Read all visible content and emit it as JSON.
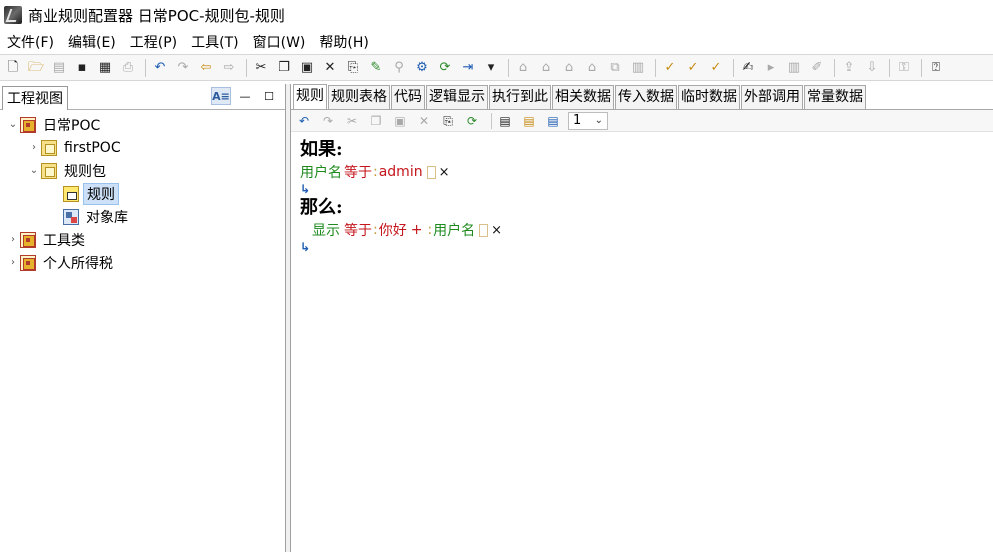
{
  "window": {
    "title": "商业规则配置器  日常POC-规则包-规则"
  },
  "menu": [
    {
      "label": "文件(F)"
    },
    {
      "label": "编辑(E)"
    },
    {
      "label": "工程(P)"
    },
    {
      "label": "工具(T)"
    },
    {
      "label": "窗口(W)"
    },
    {
      "label": "帮助(H)"
    }
  ],
  "toolbar": {
    "icons": [
      "new-file-icon",
      "open-folder-icon",
      "close-icon",
      "save-icon",
      "save-all-icon",
      "print-icon",
      "undo-icon",
      "redo-icon",
      "back-icon",
      "forward-icon",
      "cut-icon",
      "copy-icon",
      "paste-icon",
      "delete-icon",
      "export-icon",
      "magic-icon",
      "find-icon",
      "properties-icon",
      "refresh-icon",
      "indent-icon",
      "dropdown-icon",
      "build-icon",
      "build2-icon",
      "deploy-icon",
      "deploy2-icon",
      "link-icon",
      "compare-icon",
      "check-icon",
      "check2-icon",
      "check3-icon",
      "edit-icon",
      "run-icon",
      "chart-icon",
      "chart2-icon",
      "upload-icon",
      "download-icon",
      "key-icon",
      "help-icon"
    ]
  },
  "left_pane": {
    "title": "工程视图",
    "tools": [
      {
        "icon": "sort-icon",
        "glyph": "A≡"
      },
      {
        "icon": "minimize-icon",
        "glyph": "—"
      },
      {
        "icon": "maximize-icon",
        "glyph": "☐"
      }
    ],
    "tree": [
      {
        "label": "日常POC",
        "level": 0,
        "toggle": "⌄",
        "icon": "project"
      },
      {
        "label": "firstPOC",
        "level": 1,
        "toggle": "›",
        "icon": "package"
      },
      {
        "label": "规则包",
        "level": 1,
        "toggle": "⌄",
        "icon": "package"
      },
      {
        "label": "规则",
        "level": 2,
        "toggle": "",
        "icon": "rule",
        "selected": true
      },
      {
        "label": "对象库",
        "level": 2,
        "toggle": "",
        "icon": "library"
      },
      {
        "label": "工具类",
        "level": 0,
        "toggle": "›",
        "icon": "project"
      },
      {
        "label": "个人所得税",
        "level": 0,
        "toggle": "›",
        "icon": "project"
      }
    ]
  },
  "editor": {
    "tabs": [
      {
        "label": "规则",
        "active": true
      },
      {
        "label": "规则表格"
      },
      {
        "label": "代码"
      },
      {
        "label": "逻辑显示"
      },
      {
        "label": "执行到此"
      },
      {
        "label": "相关数据"
      },
      {
        "label": "传入数据"
      },
      {
        "label": "临时数据"
      },
      {
        "label": "外部调用"
      },
      {
        "label": "常量数据"
      }
    ],
    "page_select": "1",
    "if_label": "如果:",
    "then_label": "那么:",
    "condition": {
      "field": "用户名",
      "op": "等于",
      "colon": ":",
      "value": "admin",
      "x": "×"
    },
    "action": {
      "verb": "显示",
      "op": "等于",
      "colon": ":",
      "value": "你好",
      "plus": "+",
      "colon2": ":",
      "field": "用户名",
      "x": "×"
    }
  }
}
